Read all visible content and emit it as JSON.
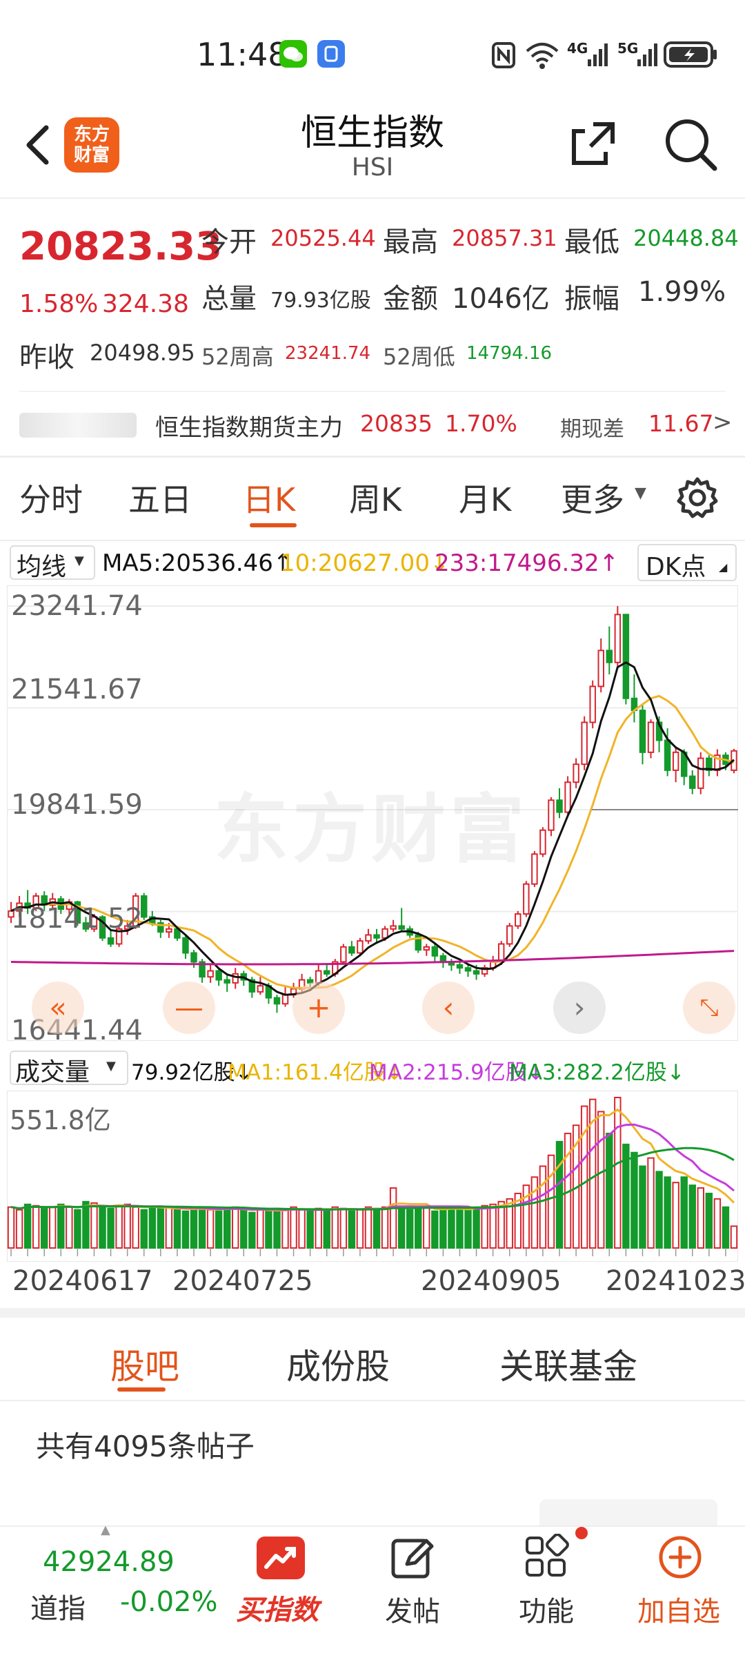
{
  "status_bar": {
    "time": "11:48",
    "network_1": "4G",
    "network_2": "5G"
  },
  "header": {
    "title": "恒生指数",
    "subtitle": "HSI",
    "logo_text_1": "东方",
    "logo_text_2": "财富"
  },
  "quote": {
    "last": "20823.33",
    "change_pct": "1.58%",
    "change": "324.38",
    "open_label": "今开",
    "open": "20525.44",
    "high_label": "最高",
    "high": "20857.31",
    "low_label": "最低",
    "low": "20448.84",
    "volume_label": "总量",
    "volume": "79.93亿股",
    "amount_label": "金额",
    "amount": "1046亿",
    "amplitude_label": "振幅",
    "amplitude": "1.99%",
    "prev_close_label": "昨收",
    "prev_close": "20498.95",
    "wk52_high_label": "52周高",
    "wk52_high": "23241.74",
    "wk52_low_label": "52周低",
    "wk52_low": "14794.16"
  },
  "futures": {
    "label": "恒生指数期货主力",
    "price": "20835",
    "change_pct": "1.70%",
    "basis_label": "期现差",
    "basis": "11.67",
    "more": ">"
  },
  "tabs": [
    "分时",
    "五日",
    "日K",
    "周K",
    "月K",
    "更多"
  ],
  "active_tab": "日K",
  "chart_header": {
    "ma_selector": "均线",
    "ma5": "MA5:20536.46↑",
    "ma10": "10:20627.00↓",
    "ma233": "233:17496.32↑",
    "dk": "DK点",
    "vol_selector": "成交量",
    "vol_value": "79.92亿股↓",
    "vol_ma1": "MA1:161.4亿股↓",
    "vol_ma2": "MA2:215.9亿股↓",
    "vol_ma3": "MA3:282.2亿股↓",
    "vol_max": "551.8亿",
    "watermark": "东方财富"
  },
  "colors": {
    "up": "#d8262f",
    "down": "#139a2b",
    "accent": "#e2541c",
    "ma5": "#111111",
    "ma10": "#f0b429",
    "ma233": "#c0198a",
    "vol_ma2": "#c53ddd"
  },
  "chart_data": {
    "type": "candlestick",
    "y_axis_labels": [
      "23241.74",
      "21541.67",
      "19841.59",
      "18141.52",
      "16441.44"
    ],
    "ylim": [
      16441.44,
      23241.74
    ],
    "x_labels": [
      "20240617",
      "20240725",
      "20240905",
      "20241023"
    ],
    "candles": [
      [
        18050,
        18150,
        18300,
        17950
      ],
      [
        18150,
        18280,
        18400,
        18050
      ],
      [
        18280,
        18200,
        18500,
        18100
      ],
      [
        18200,
        18400,
        18450,
        18150
      ],
      [
        18400,
        18250,
        18480,
        18150
      ],
      [
        18250,
        18350,
        18450,
        18200
      ],
      [
        18350,
        18180,
        18400,
        18100
      ],
      [
        18180,
        18300,
        18350,
        18050
      ],
      [
        18300,
        17950,
        18320,
        17900
      ],
      [
        17950,
        17850,
        18050,
        17800
      ],
      [
        17850,
        18050,
        18100,
        17800
      ],
      [
        18050,
        17700,
        18080,
        17650
      ],
      [
        17700,
        17600,
        17850,
        17550
      ],
      [
        17600,
        17850,
        17900,
        17550
      ],
      [
        17850,
        17900,
        18000,
        17750
      ],
      [
        17900,
        18400,
        18450,
        17850
      ],
      [
        18400,
        18050,
        18450,
        18000
      ],
      [
        18050,
        17950,
        18150,
        17900
      ],
      [
        17950,
        17800,
        18000,
        17700
      ],
      [
        17800,
        17850,
        17950,
        17700
      ],
      [
        17850,
        17700,
        17900,
        17650
      ],
      [
        17700,
        17450,
        17750,
        17350
      ],
      [
        17450,
        17300,
        17500,
        17200
      ],
      [
        17300,
        17050,
        17350,
        16950
      ],
      [
        17050,
        17150,
        17250,
        16950
      ],
      [
        17150,
        17000,
        17200,
        16900
      ],
      [
        17000,
        16950,
        17100,
        16800
      ],
      [
        16950,
        17100,
        17200,
        16850
      ],
      [
        17100,
        17000,
        17150,
        16900
      ],
      [
        17000,
        16800,
        17050,
        16700
      ],
      [
        16800,
        16900,
        17050,
        16750
      ],
      [
        16900,
        16700,
        16950,
        16600
      ],
      [
        16700,
        16600,
        16750,
        16450
      ],
      [
        16600,
        16750,
        16900,
        16550
      ],
      [
        16750,
        16850,
        16950,
        16700
      ],
      [
        16850,
        17000,
        17100,
        16800
      ],
      [
        17000,
        16950,
        17050,
        16850
      ],
      [
        16950,
        17150,
        17250,
        16900
      ],
      [
        17150,
        17100,
        17250,
        17050
      ],
      [
        17100,
        17300,
        17350,
        17050
      ],
      [
        17300,
        17550,
        17600,
        17250
      ],
      [
        17550,
        17450,
        17650,
        17400
      ],
      [
        17450,
        17650,
        17700,
        17400
      ],
      [
        17650,
        17750,
        17850,
        17600
      ],
      [
        17750,
        17700,
        17850,
        17600
      ],
      [
        17700,
        17850,
        17900,
        17650
      ],
      [
        17850,
        17900,
        18000,
        17800
      ],
      [
        17900,
        17850,
        18200,
        17800
      ],
      [
        17850,
        17750,
        17900,
        17700
      ],
      [
        17750,
        17500,
        17800,
        17450
      ],
      [
        17500,
        17550,
        17600,
        17400
      ],
      [
        17550,
        17400,
        17600,
        17300
      ],
      [
        17400,
        17300,
        17450,
        17200
      ],
      [
        17300,
        17250,
        17350,
        17150
      ],
      [
        17250,
        17200,
        17300,
        17100
      ],
      [
        17200,
        17150,
        17250,
        17050
      ],
      [
        17150,
        17100,
        17250,
        17000
      ],
      [
        17100,
        17200,
        17250,
        17050
      ],
      [
        17200,
        17300,
        17400,
        17150
      ],
      [
        17300,
        17600,
        17650,
        17250
      ],
      [
        17600,
        17900,
        17950,
        17550
      ],
      [
        17900,
        18100,
        18150,
        17850
      ],
      [
        18100,
        18600,
        18650,
        18050
      ],
      [
        18600,
        19100,
        19150,
        18550
      ],
      [
        19100,
        19500,
        19550,
        19050
      ],
      [
        19500,
        20000,
        20050,
        19400
      ],
      [
        20000,
        19800,
        20200,
        19700
      ],
      [
        19800,
        20300,
        20400,
        19750
      ],
      [
        20300,
        20600,
        20700,
        20200
      ],
      [
        20600,
        21300,
        21400,
        20500
      ],
      [
        21300,
        21900,
        22000,
        21200
      ],
      [
        21900,
        22500,
        22700,
        21800
      ],
      [
        22500,
        22300,
        22900,
        22100
      ],
      [
        22300,
        23100,
        23241.74,
        22200
      ],
      [
        23100,
        21700,
        23100,
        21600
      ],
      [
        21700,
        21500,
        22100,
        21300
      ],
      [
        21500,
        20800,
        21600,
        20600
      ],
      [
        20800,
        21300,
        21350,
        20700
      ],
      [
        21300,
        21000,
        21400,
        20800
      ],
      [
        21000,
        20500,
        21200,
        20400
      ],
      [
        20500,
        20800,
        20900,
        20300
      ],
      [
        20800,
        20400,
        20850,
        20250
      ],
      [
        20400,
        20200,
        20500,
        20100
      ],
      [
        20200,
        20700,
        20800,
        20100
      ],
      [
        20700,
        20500,
        20750,
        20400
      ],
      [
        20500,
        20750,
        20850,
        20400
      ],
      [
        20750,
        20600,
        20800,
        20500
      ],
      [
        20500,
        20823.33,
        20857.31,
        20448.84
      ]
    ],
    "volume_max": 551.8,
    "volumes": [
      150,
      140,
      160,
      155,
      145,
      150,
      160,
      150,
      140,
      170,
      165,
      150,
      145,
      155,
      160,
      150,
      140,
      150,
      145,
      150,
      140,
      135,
      145,
      150,
      140,
      135,
      145,
      150,
      140,
      130,
      140,
      135,
      145,
      140,
      150,
      140,
      135,
      145,
      140,
      150,
      145,
      135,
      140,
      150,
      145,
      150,
      220,
      150,
      140,
      145,
      150,
      135,
      140,
      150,
      145,
      140,
      150,
      155,
      160,
      170,
      180,
      200,
      230,
      260,
      300,
      340,
      390,
      420,
      450,
      520,
      545,
      500,
      420,
      551.8,
      380,
      350,
      300,
      330,
      280,
      260,
      240,
      260,
      230,
      220,
      200,
      180,
      150,
      80
    ]
  },
  "bottom_tabs": [
    "股吧",
    "成份股",
    "关联基金"
  ],
  "active_bottom_tab": "股吧",
  "posts_count": "共有4095条帖子",
  "bottom_nav": {
    "dow_value": "42924.89",
    "dow_label": "道指",
    "dow_change": "-0.02%",
    "buy_index": "买指数",
    "post": "发帖",
    "function": "功能",
    "add_watch": "加自选"
  }
}
